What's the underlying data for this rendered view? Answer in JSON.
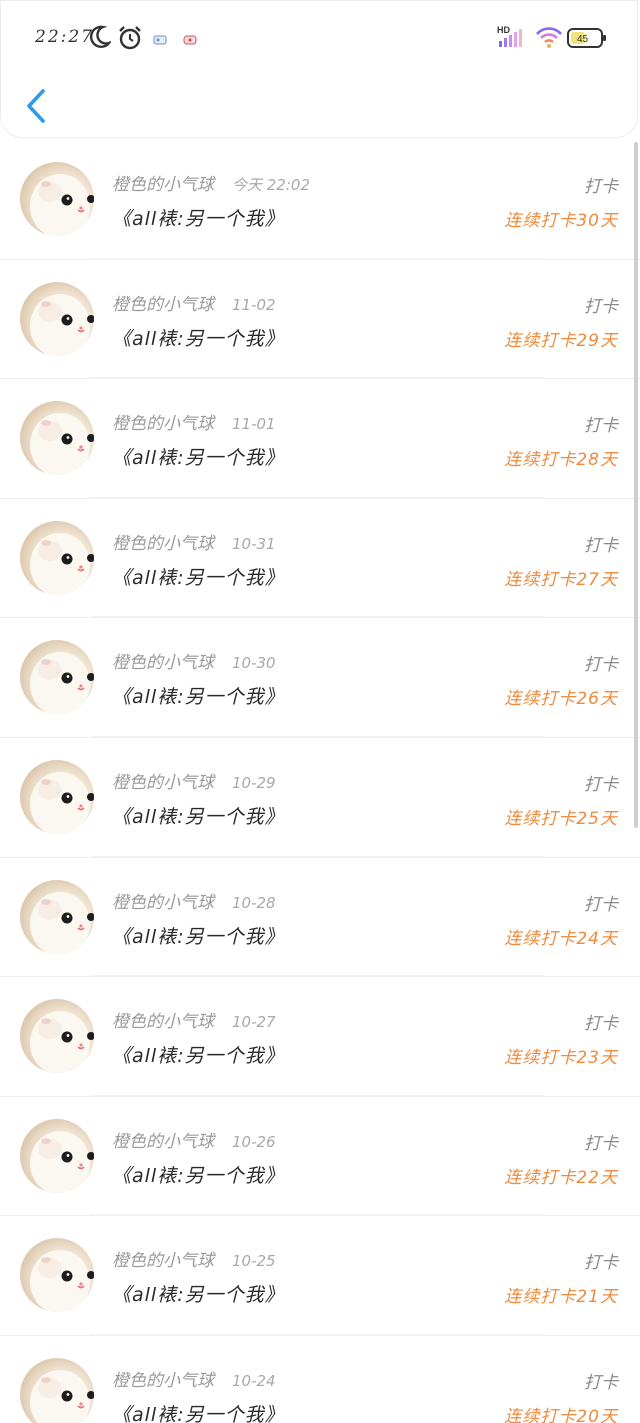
{
  "status_bar": {
    "time": "22:27",
    "icons": [
      "moon-icon",
      "alarm-icon",
      "app-notification-icon",
      "app-notification-icon-2",
      "hd-signal-icon",
      "wifi-icon",
      "battery-icon"
    ],
    "battery_level": "45",
    "network_label": "HD"
  },
  "header": {
    "back_icon": "chevron-left-icon"
  },
  "colors": {
    "accent": "#2f9be6",
    "streak": "#f08a3c",
    "muted_text": "#9b9b9b"
  },
  "records": [
    {
      "user": "橙色的小气球",
      "date": "今天 22:02",
      "book": "《all裱:另一个我》",
      "action": "打卡",
      "streak": "连续打卡30天"
    },
    {
      "user": "橙色的小气球",
      "date": "11-02",
      "book": "《all裱:另一个我》",
      "action": "打卡",
      "streak": "连续打卡29天"
    },
    {
      "user": "橙色的小气球",
      "date": "11-01",
      "book": "《all裱:另一个我》",
      "action": "打卡",
      "streak": "连续打卡28天"
    },
    {
      "user": "橙色的小气球",
      "date": "10-31",
      "book": "《all裱:另一个我》",
      "action": "打卡",
      "streak": "连续打卡27天"
    },
    {
      "user": "橙色的小气球",
      "date": "10-30",
      "book": "《all裱:另一个我》",
      "action": "打卡",
      "streak": "连续打卡26天"
    },
    {
      "user": "橙色的小气球",
      "date": "10-29",
      "book": "《all裱:另一个我》",
      "action": "打卡",
      "streak": "连续打卡25天"
    },
    {
      "user": "橙色的小气球",
      "date": "10-28",
      "book": "《all裱:另一个我》",
      "action": "打卡",
      "streak": "连续打卡24天"
    },
    {
      "user": "橙色的小气球",
      "date": "10-27",
      "book": "《all裱:另一个我》",
      "action": "打卡",
      "streak": "连续打卡23天"
    },
    {
      "user": "橙色的小气球",
      "date": "10-26",
      "book": "《all裱:另一个我》",
      "action": "打卡",
      "streak": "连续打卡22天"
    },
    {
      "user": "橙色的小气球",
      "date": "10-25",
      "book": "《all裱:另一个我》",
      "action": "打卡",
      "streak": "连续打卡21天"
    },
    {
      "user": "橙色的小气球",
      "date": "10-24",
      "book": "《all裱:另一个我》",
      "action": "打卡",
      "streak": "连续打卡20天"
    }
  ]
}
